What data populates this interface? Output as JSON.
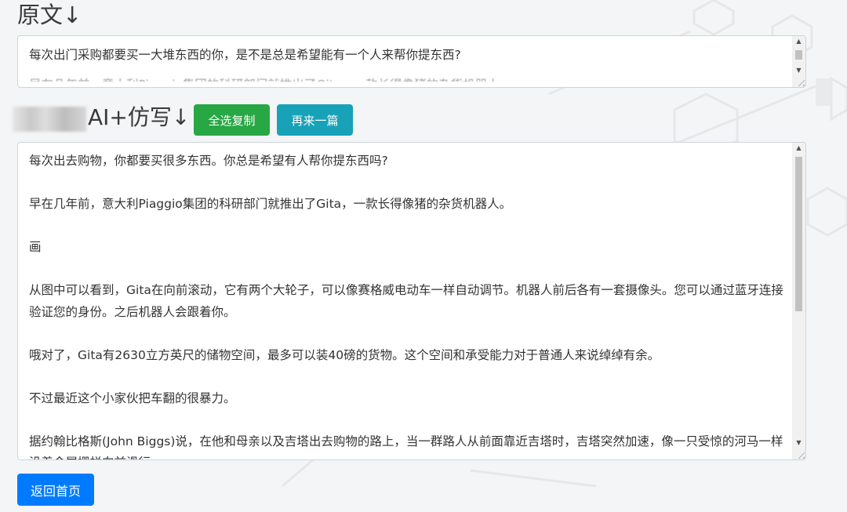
{
  "original": {
    "heading": "原文↓",
    "text": "每次出门采购都要买一大堆东西的你，是不是总是希望能有一个人来帮你提东西?",
    "text_partial": "早在几年前，意大利Piaggio集团的科研部门就推出了Gita，一款长得像猪的杂货机器人。"
  },
  "rewrite": {
    "heading": "AI+仿写↓",
    "copy_button": "全选复制",
    "again_button": "再来一篇",
    "paragraphs": [
      "每次出去购物，你都要买很多东西。你总是希望有人帮你提东西吗?",
      "早在几年前，意大利Piaggio集团的科研部门就推出了Gita，一款长得像猪的杂货机器人。",
      "画",
      "从图中可以看到，Gita在向前滚动，它有两个大轮子，可以像赛格威电动车一样自动调节。机器人前后各有一套摄像头。您可以通过蓝牙连接验证您的身份。之后机器人会跟着你。",
      "哦对了，Gita有2630立方英尺的储物空间，最多可以装40磅的货物。这个空间和承受能力对于普通人来说绰绰有余。",
      "不过最近这个小家伙把车翻的很暴力。",
      "据约翰比格斯(John Biggs)说，在他和母亲以及吉塔出去购物的路上，当一群路人从前面靠近吉塔时，吉塔突然加速，像一只受惊的河马一样沿着金属栅栏向前滑行。"
    ]
  },
  "home_button": "返回首页",
  "colors": {
    "copy": "#28a745",
    "again": "#17a2b8",
    "home": "#007bff"
  }
}
